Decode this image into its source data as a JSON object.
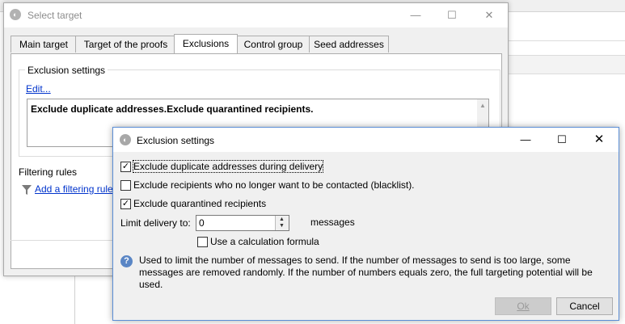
{
  "main_dialog": {
    "title": "Select target",
    "tabs": [
      {
        "label": "Main target"
      },
      {
        "label": "Target of the proofs"
      },
      {
        "label": "Exclusions",
        "active": true
      },
      {
        "label": "Control group"
      },
      {
        "label": "Seed addresses"
      }
    ],
    "exclusion_settings_label": "Exclusion settings",
    "edit_link": "Edit...",
    "summary_text": "Exclude duplicate addresses.Exclude quarantined recipients.",
    "filtering_rules_label": "Filtering rules",
    "add_filter_link": "Add a filtering rule"
  },
  "exclusion_dialog": {
    "title": "Exclusion settings",
    "options": [
      {
        "label": "Exclude duplicate addresses during delivery",
        "checked": true
      },
      {
        "label": "Exclude recipients who no longer want to be contacted (blacklist).",
        "checked": false
      },
      {
        "label": "Exclude quarantined recipients",
        "checked": true
      }
    ],
    "limit_label": "Limit delivery to:",
    "limit_value": "0",
    "limit_unit": "messages",
    "calc_formula_label": "Use a calculation formula",
    "calc_formula_checked": false,
    "help_text": "Used to limit the number of messages to send. If the number of messages to send is too large, some messages are removed randomly. If the number of numbers equals zero, the full targeting potential will be used.",
    "ok_label": "Ok",
    "cancel_label": "Cancel"
  }
}
